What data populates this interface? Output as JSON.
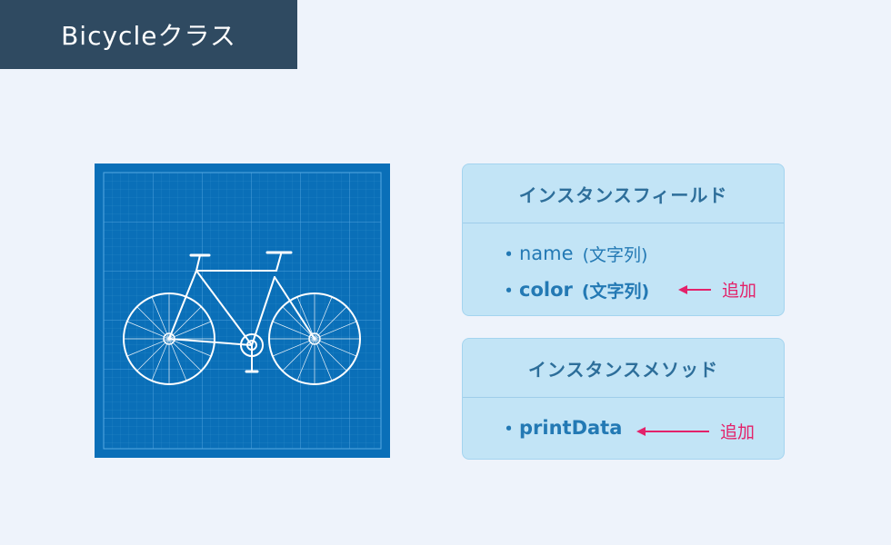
{
  "title": "Bicycleクラス",
  "blueprint": {
    "icon": "bicycle-blueprint-icon",
    "background_color": "#0a6fb8"
  },
  "fields_card": {
    "header": "インスタンスフィールド",
    "items": [
      {
        "bullet": "・",
        "name": "name",
        "type": "(文字列)",
        "added": false
      },
      {
        "bullet": "・",
        "name": "color",
        "type": "(文字列)",
        "added": true
      }
    ]
  },
  "methods_card": {
    "header": "インスタンスメソッド",
    "items": [
      {
        "bullet": "・",
        "name": "printData",
        "added": true
      }
    ]
  },
  "annotation_label": "追加",
  "colors": {
    "title_bg": "#2f4a61",
    "card_bg": "#c2e4f6",
    "card_text": "#2379b4",
    "accent": "#e3226a",
    "page_bg": "#eef3fb"
  }
}
